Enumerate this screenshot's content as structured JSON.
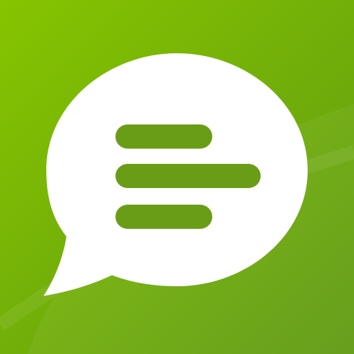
{
  "app_icon": {
    "icon_name": "chat-bubble-text-lines-icon",
    "colors": {
      "background_top": "#86c400",
      "background_bottom": "#5f9a12",
      "bubble": "#ffffff",
      "lines": "#6a9d16"
    }
  }
}
